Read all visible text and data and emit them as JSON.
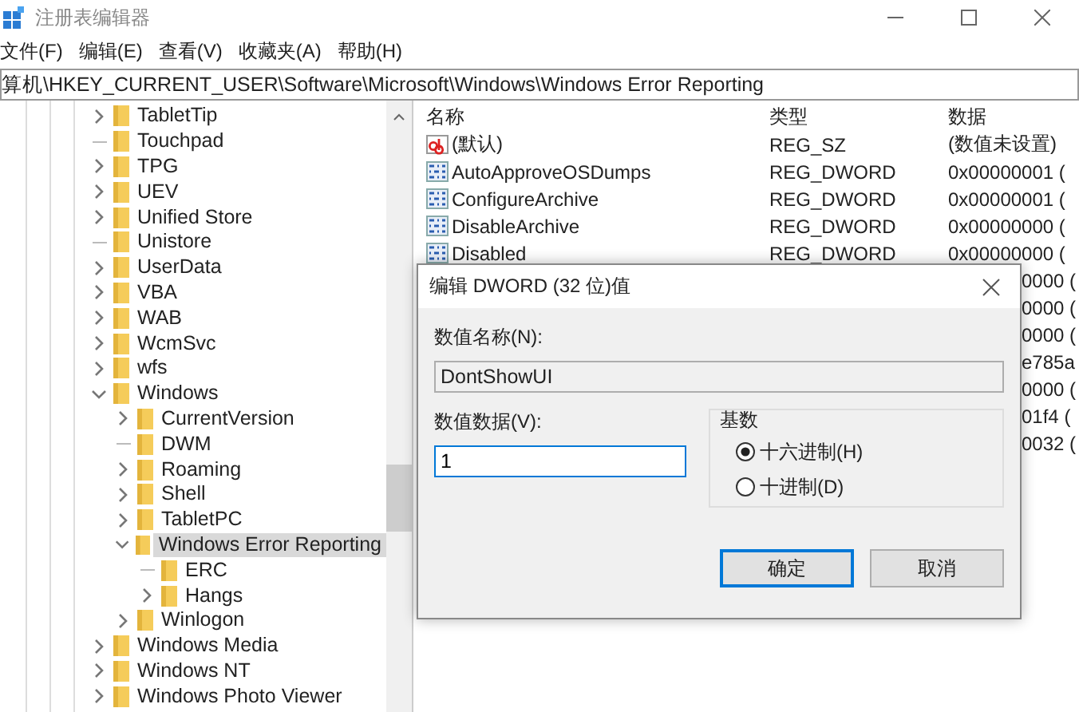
{
  "window": {
    "title": "注册表编辑器"
  },
  "menu": [
    "文件(F)",
    "编辑(E)",
    "查看(V)",
    "收藏夹(A)",
    "帮助(H)"
  ],
  "address": "算机\\HKEY_CURRENT_USER\\Software\\Microsoft\\Windows\\Windows Error Reporting",
  "tree": [
    {
      "label": "TabletTip",
      "kind": "branch",
      "expanded": false,
      "selected": false
    },
    {
      "label": "Touchpad",
      "kind": "leaf",
      "expanded": false,
      "selected": false
    },
    {
      "label": "TPG",
      "kind": "branch",
      "expanded": false,
      "selected": false
    },
    {
      "label": "UEV",
      "kind": "branch",
      "expanded": false,
      "selected": false
    },
    {
      "label": "Unified Store",
      "kind": "branch",
      "expanded": false,
      "selected": false
    },
    {
      "label": "Unistore",
      "kind": "leaf",
      "expanded": false,
      "selected": false
    },
    {
      "label": "UserData",
      "kind": "branch",
      "expanded": false,
      "selected": false
    },
    {
      "label": "VBA",
      "kind": "branch",
      "expanded": false,
      "selected": false
    },
    {
      "label": "WAB",
      "kind": "branch",
      "expanded": false,
      "selected": false
    },
    {
      "label": "WcmSvc",
      "kind": "branch",
      "expanded": false,
      "selected": false
    },
    {
      "label": "wfs",
      "kind": "branch",
      "expanded": false,
      "selected": false
    },
    {
      "label": "Windows",
      "kind": "branch",
      "expanded": true,
      "selected": false,
      "children": [
        {
          "label": "CurrentVersion",
          "kind": "branch",
          "expanded": false,
          "selected": false
        },
        {
          "label": "DWM",
          "kind": "leaf",
          "expanded": false,
          "selected": false
        },
        {
          "label": "Roaming",
          "kind": "branch",
          "expanded": false,
          "selected": false
        },
        {
          "label": "Shell",
          "kind": "branch",
          "expanded": false,
          "selected": false
        },
        {
          "label": "TabletPC",
          "kind": "branch",
          "expanded": false,
          "selected": false
        },
        {
          "label": "Windows Error Reporting",
          "kind": "branch",
          "expanded": true,
          "selected": true,
          "children": [
            {
              "label": "ERC",
              "kind": "leaf",
              "expanded": false,
              "selected": false
            },
            {
              "label": "Hangs",
              "kind": "branch",
              "expanded": false,
              "selected": false
            }
          ]
        },
        {
          "label": "Winlogon",
          "kind": "branch",
          "expanded": false,
          "selected": false
        }
      ]
    },
    {
      "label": "Windows Media",
      "kind": "branch",
      "expanded": false,
      "selected": false
    },
    {
      "label": "Windows NT",
      "kind": "branch",
      "expanded": false,
      "selected": false
    },
    {
      "label": "Windows Photo Viewer",
      "kind": "branch",
      "expanded": false,
      "selected": false
    }
  ],
  "list": {
    "columns": [
      "名称",
      "类型",
      "数据"
    ],
    "rows": [
      {
        "kind": "string",
        "name": "(默认)",
        "type": "REG_SZ",
        "data": "(数值未设置)"
      },
      {
        "kind": "binary",
        "name": "AutoApproveOSDumps",
        "type": "REG_DWORD",
        "data": "0x00000001 ("
      },
      {
        "kind": "binary",
        "name": "ConfigureArchive",
        "type": "REG_DWORD",
        "data": "0x00000001 ("
      },
      {
        "kind": "binary",
        "name": "DisableArchive",
        "type": "REG_DWORD",
        "data": "0x00000000 ("
      },
      {
        "kind": "binary",
        "name": "Disabled",
        "type": "REG_DWORD",
        "data": "0x00000000 ("
      },
      {
        "kind": "hidden",
        "data": "0000 ("
      },
      {
        "kind": "hidden",
        "data": "0000 ("
      },
      {
        "kind": "hidden",
        "data": "0000 ("
      },
      {
        "kind": "hidden",
        "data": "e785a"
      },
      {
        "kind": "hidden",
        "data": "0000 ("
      },
      {
        "kind": "hidden",
        "data": "01f4 ("
      },
      {
        "kind": "hidden",
        "data": "0032 ("
      }
    ]
  },
  "dialog": {
    "title": "编辑 DWORD (32 位)值",
    "name_label": "数值名称(N):",
    "name_value": "DontShowUI",
    "data_label": "数值数据(V):",
    "data_value": "1",
    "base_label": "基数",
    "radios": [
      {
        "label": "十六进制(H)",
        "selected": true
      },
      {
        "label": "十进制(D)",
        "selected": false
      }
    ],
    "buttons": [
      {
        "label": "确定",
        "default": true
      },
      {
        "label": "取消",
        "default": false
      }
    ]
  }
}
